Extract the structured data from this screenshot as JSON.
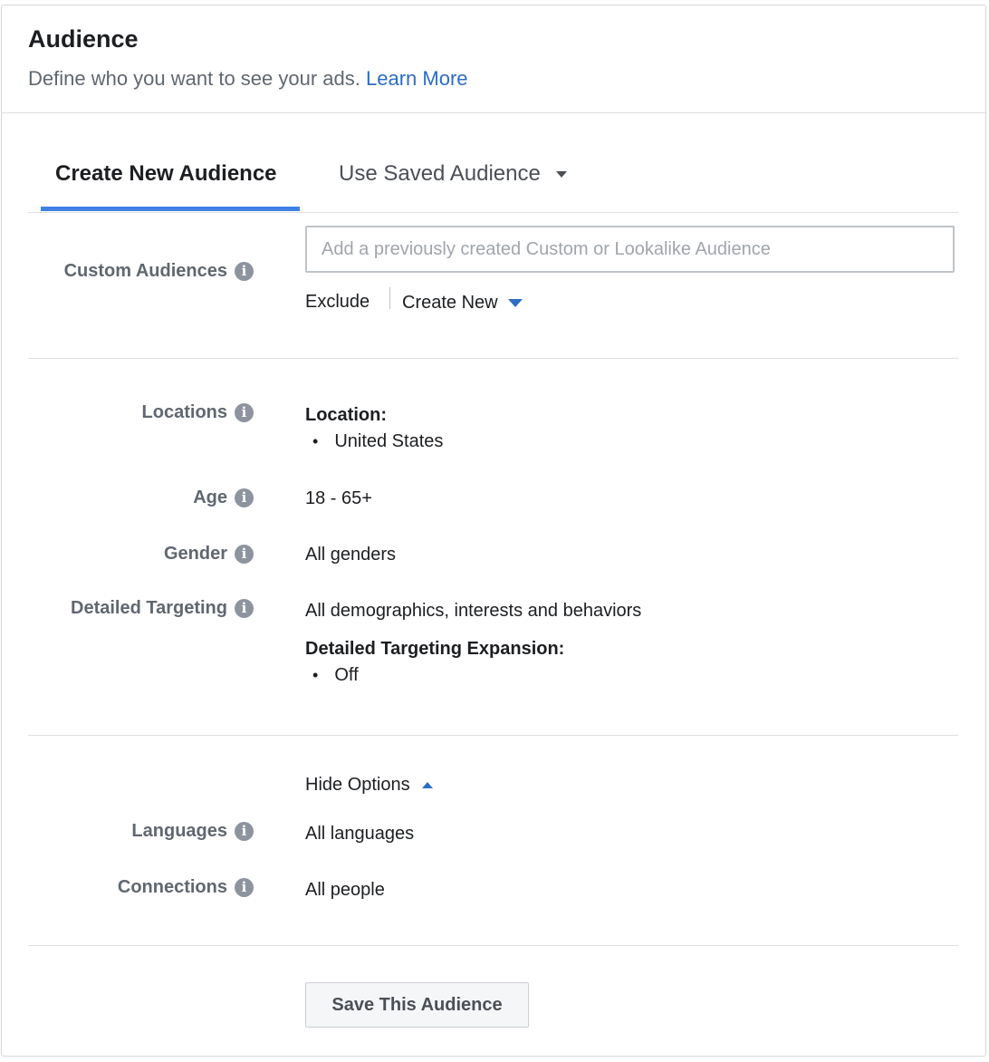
{
  "header": {
    "title": "Audience",
    "subtitle": "Define who you want to see your ads.",
    "learn_more": "Learn More"
  },
  "tabs": [
    {
      "label": "Create New Audience",
      "active": true
    },
    {
      "label": "Use Saved Audience",
      "active": false
    }
  ],
  "custom_audiences": {
    "label": "Custom Audiences",
    "placeholder": "Add a previously created Custom or Lookalike Audience",
    "exclude": "Exclude",
    "create_new": "Create New"
  },
  "locations": {
    "label": "Locations",
    "heading": "Location:",
    "items": [
      "United States"
    ]
  },
  "age": {
    "label": "Age",
    "value": "18 - 65+"
  },
  "gender": {
    "label": "Gender",
    "value": "All genders"
  },
  "detailed_targeting": {
    "label": "Detailed Targeting",
    "value": "All demographics, interests and behaviors",
    "expansion_heading": "Detailed Targeting Expansion:",
    "expansion_items": [
      "Off"
    ]
  },
  "options": {
    "hide_label": "Hide Options"
  },
  "languages": {
    "label": "Languages",
    "value": "All languages"
  },
  "connections": {
    "label": "Connections",
    "value": "All people"
  },
  "save_button": "Save This Audience",
  "info_glyph": "i",
  "bullet_glyph": "•",
  "colors": {
    "link": "#2d6dc4",
    "tab_underline": "#4080e6",
    "label": "#606770"
  }
}
